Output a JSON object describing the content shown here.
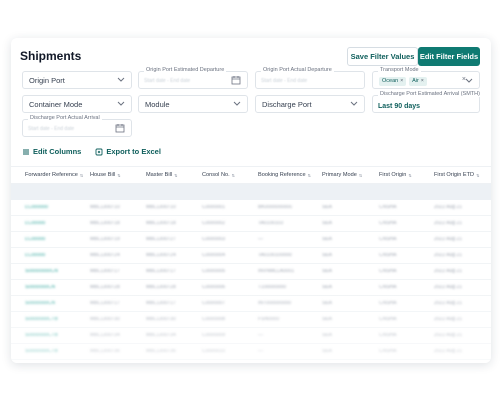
{
  "header": {
    "title": "Shipments",
    "save_filter_label": "Save Filter Values",
    "edit_filter_label": "Edit Filter Fields"
  },
  "filters": {
    "origin_port": "Origin Port",
    "origin_etd": {
      "label": "Origin Port Estimated Departure",
      "placeholder": "Start date - End date"
    },
    "origin_atd": {
      "label": "Origin Port Actual Departure",
      "placeholder": "Start date - End date"
    },
    "transport_mode": {
      "label": "Transport Mode",
      "chips": [
        "Ocean",
        "Air"
      ]
    },
    "container_mode": "Container Mode",
    "module": "Module",
    "discharge_port": "Discharge Port",
    "discharge_eta": {
      "label": "Discharge Port Estimated Arrival (SMTH)",
      "value": "Last 90 days"
    },
    "discharge_ata": {
      "label": "Discharge Port Actual Arrival",
      "placeholder": "Start date - End date"
    }
  },
  "actions": {
    "edit_columns": "Edit Columns",
    "export_excel": "Export to Excel"
  },
  "table": {
    "columns": [
      "Forwarder Reference",
      "House Bill",
      "Master Bill",
      "Consol No.",
      "Booking Reference",
      "Primary Mode",
      "First Origin",
      "First Origin ETD"
    ],
    "rows": [
      [
        "LC000000",
        "MBL1300710",
        "MBL1300710",
        "C0000001",
        "BK0000000000",
        "SEA",
        "CNSHA",
        "2022 Aug 21"
      ],
      [
        "LC00000",
        "MBL1300718",
        "MBL1300718",
        "C0000002",
        "TA0100103",
        "SEA",
        "CNSHA",
        "2022 Aug 21"
      ],
      [
        "LC00000",
        "MBL1300719",
        "MBL1300727",
        "C0000003",
        "—",
        "SEA",
        "CNSHA",
        "2022 Aug 21"
      ],
      [
        "LC00000",
        "MBL1300724",
        "MBL1300724",
        "C0000004",
        "TA0100100000",
        "SEA",
        "CNSHA",
        "2022 Aug 21"
      ],
      [
        "S00000000CN",
        "MBL1300717",
        "MBL1300717",
        "C0000005",
        "INVNMLLA0001",
        "SEA",
        "CNSHA",
        "2022 Aug 21"
      ],
      [
        "S0000000CN",
        "MBL1300728",
        "MBL1300728",
        "C0000006",
        "T100000000",
        "SEA",
        "CNSHA",
        "2022 Aug 21"
      ],
      [
        "S0000000CN",
        "MBL1300717",
        "MBL1300717",
        "C0000007",
        "INT000000000",
        "SEA",
        "CNSHA",
        "2022 Aug 21"
      ],
      [
        "S0000000CTB",
        "MBL1300730",
        "MBL1300730",
        "C0000008",
        "FSN0000",
        "SEA",
        "CNSHA",
        "2022 Aug 21"
      ],
      [
        "S0000000CTB",
        "MBL1300734",
        "MBL1300734",
        "C0000009",
        "—",
        "SEA",
        "CNSHA",
        "2022 Aug 21"
      ],
      [
        "S0000000CTB",
        "MBL1300736",
        "MBL1300736",
        "C0000010",
        "—",
        "SEA",
        "CNSHA",
        "2022 Aug 21"
      ]
    ]
  },
  "colors": {
    "accent": "#0f7a72",
    "link": "#2ba39a",
    "text": "#1f2a37"
  }
}
